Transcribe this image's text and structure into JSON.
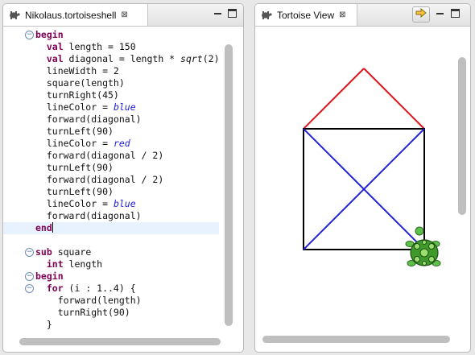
{
  "editor": {
    "tab_label": "Nikolaus.tortoiseshell",
    "close_glyph": "⊠",
    "tab_icon": "tortoise-icon",
    "code_lines": [
      [
        {
          "t": "begin",
          "c": "kw"
        }
      ],
      [
        {
          "t": "  val",
          "c": "kw"
        },
        {
          "t": " length = 150"
        }
      ],
      [
        {
          "t": "  val",
          "c": "kw"
        },
        {
          "t": " diagonal = length * "
        },
        {
          "t": "sqrt",
          "c": "fn"
        },
        {
          "t": "(2)"
        }
      ],
      [
        {
          "t": "  lineWidth = 2"
        }
      ],
      [
        {
          "t": "  square(length)"
        }
      ],
      [
        {
          "t": "  turnRight(45)"
        }
      ],
      [
        {
          "t": "  lineColor = "
        },
        {
          "t": "blue",
          "c": "it"
        }
      ],
      [
        {
          "t": "  forward(diagonal)"
        }
      ],
      [
        {
          "t": "  turnLeft(90)"
        }
      ],
      [
        {
          "t": "  lineColor = "
        },
        {
          "t": "red",
          "c": "it"
        }
      ],
      [
        {
          "t": "  forward(diagonal / 2)"
        }
      ],
      [
        {
          "t": "  turnLeft(90)"
        }
      ],
      [
        {
          "t": "  forward(diagonal / 2)"
        }
      ],
      [
        {
          "t": "  turnLeft(90)"
        }
      ],
      [
        {
          "t": "  lineColor = "
        },
        {
          "t": "blue",
          "c": "it"
        }
      ],
      [
        {
          "t": "  forward(diagonal)"
        }
      ],
      [
        {
          "t": "end",
          "c": "kw"
        }
      ],
      [],
      [
        {
          "t": "sub",
          "c": "kw"
        },
        {
          "t": " square"
        }
      ],
      [
        {
          "t": "  int",
          "c": "kw"
        },
        {
          "t": " length"
        }
      ],
      [
        {
          "t": "begin",
          "c": "kw"
        }
      ],
      [
        {
          "t": "  for",
          "c": "kw"
        },
        {
          "t": " (i : 1..4) {"
        }
      ],
      [
        {
          "t": "    forward(length)"
        }
      ],
      [
        {
          "t": "    turnRight(90)"
        }
      ],
      [
        {
          "t": "  }"
        }
      ]
    ],
    "fold_markers": [
      "−",
      "−",
      "−",
      "−"
    ]
  },
  "view": {
    "tab_label": "Tortoise View",
    "close_glyph": "⊠",
    "tab_icon": "tortoise-icon",
    "pin_icon": "pin-icon",
    "drawing": {
      "roof_color": "#e0141a",
      "square_color": "#000000",
      "diagonal_color": "#1f22d8",
      "tortoise_icon": "tortoise-icon"
    }
  },
  "colors": {
    "keyword": "#7f0055",
    "italic_value": "#1d1de0",
    "current_line": "#e8f2fe"
  }
}
